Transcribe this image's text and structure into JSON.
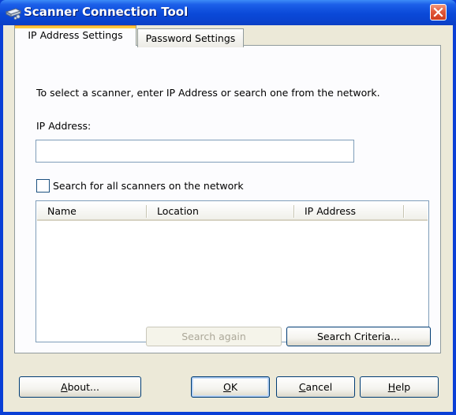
{
  "window": {
    "title": "Scanner Connection Tool",
    "accent_color": "#0a49d8",
    "close_color": "#e2583b"
  },
  "tabs": [
    {
      "label": "IP Address Settings",
      "selected": true
    },
    {
      "label": "Password Settings",
      "selected": false
    }
  ],
  "panel": {
    "instructions": "To select a scanner, enter IP Address or search one from the network.",
    "ip_label": "IP Address:",
    "ip_value": "",
    "search_all_label": "Search for all scanners on the network",
    "search_all_checked": false
  },
  "list": {
    "columns": [
      "Name",
      "Location",
      "IP Address"
    ],
    "rows": []
  },
  "panel_buttons": {
    "search_again": "Search again",
    "search_criteria": "Search Criteria..."
  },
  "footer": {
    "about_prefix": "A",
    "about_rest": "bout...",
    "ok_prefix": "O",
    "ok_rest": "K",
    "cancel_prefix": "C",
    "cancel_rest": "ancel",
    "help_prefix": "H",
    "help_rest": "elp"
  }
}
